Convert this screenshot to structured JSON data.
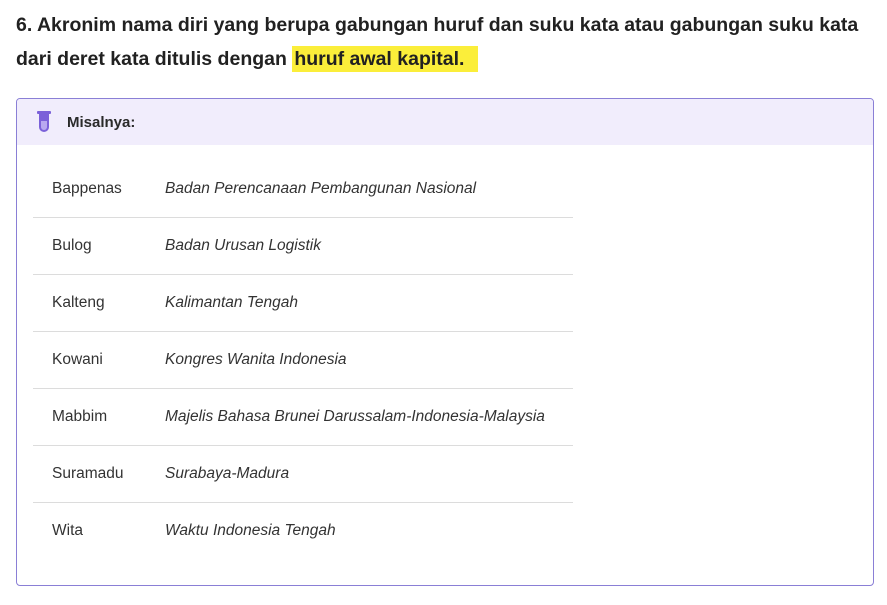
{
  "rule": {
    "text_before": "6. Akronim nama diri yang berupa gabungan huruf dan suku kata atau gabungan suku kata dari deret kata ditulis dengan ",
    "highlighted_text": "huruf awal kapital."
  },
  "example_box": {
    "title": "Misalnya:",
    "icon": "test-tube-icon",
    "accent_color": "#7b61d9",
    "header_bg": "#f1edfc",
    "rows": [
      {
        "acronym": "Bappenas",
        "expansion": "Badan Perencanaan Pembangunan Nasional"
      },
      {
        "acronym": "Bulog",
        "expansion": "Badan Urusan Logistik"
      },
      {
        "acronym": "Kalteng",
        "expansion": "Kalimantan Tengah"
      },
      {
        "acronym": "Kowani",
        "expansion": "Kongres Wanita Indonesia"
      },
      {
        "acronym": "Mabbim",
        "expansion": "Majelis Bahasa Brunei Darussalam-Indonesia-Malaysia"
      },
      {
        "acronym": "Suramadu",
        "expansion": "Surabaya-Madura"
      },
      {
        "acronym": "Wita",
        "expansion": "Waktu Indonesia Tengah"
      }
    ]
  },
  "highlight_color": "#fbee3a"
}
